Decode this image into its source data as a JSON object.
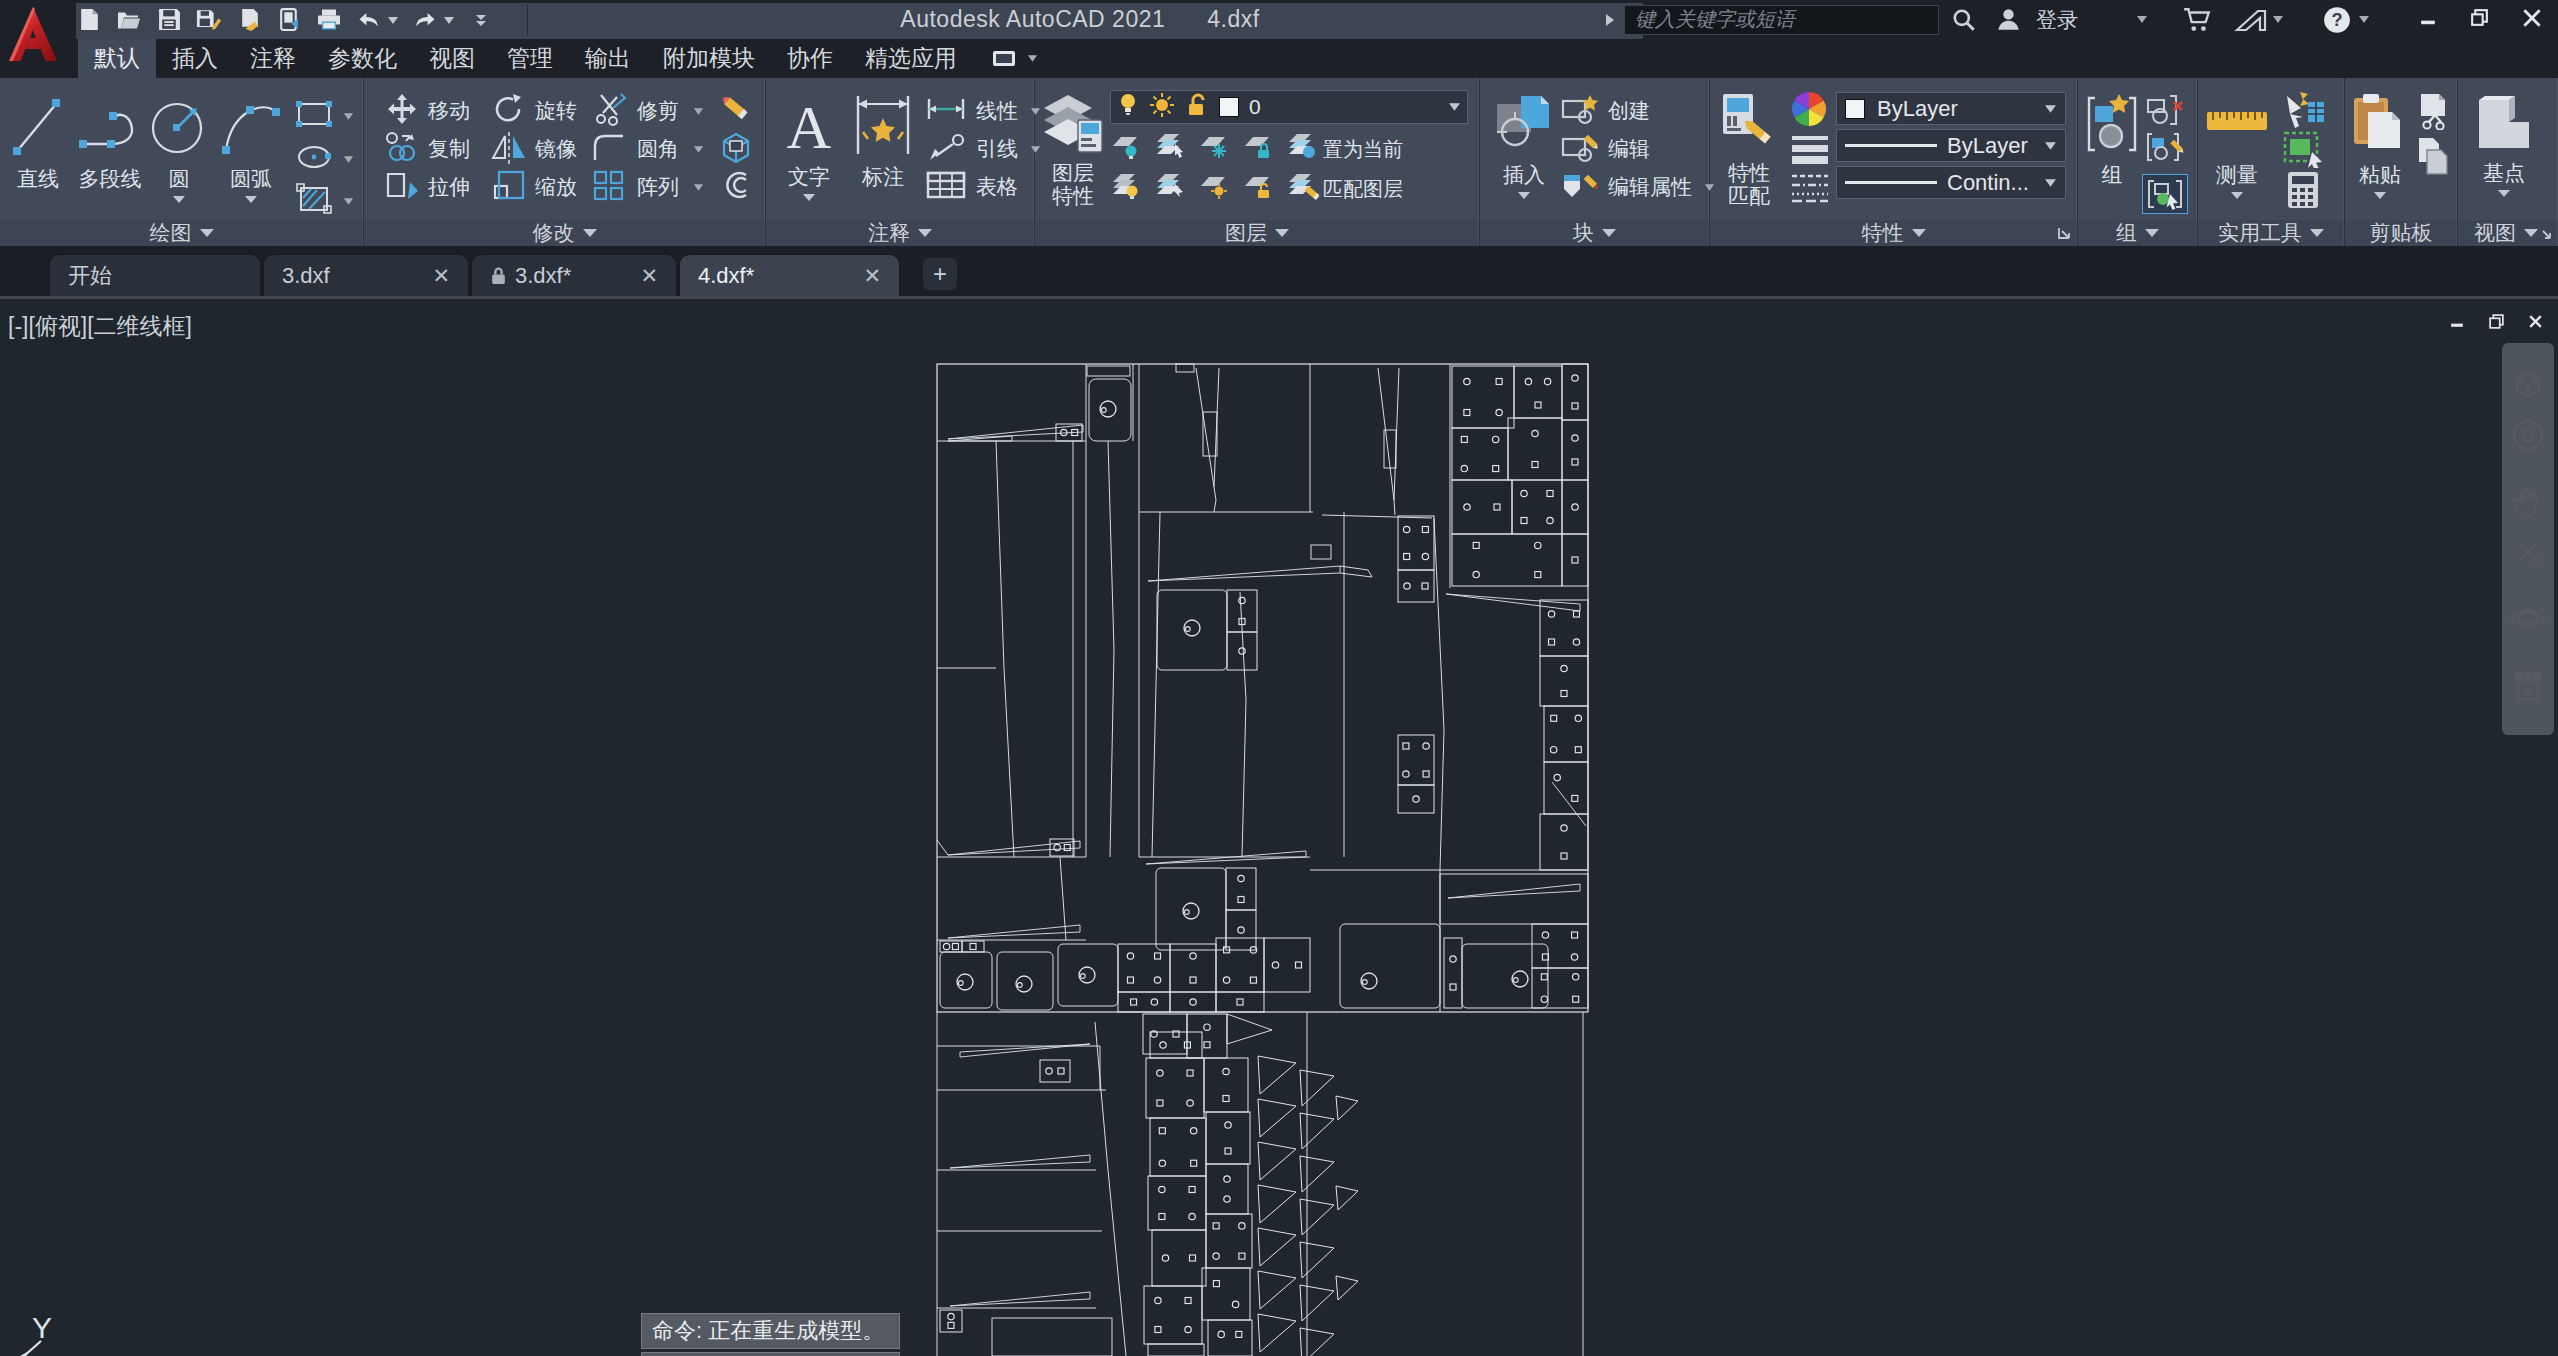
{
  "window": {
    "title_app": "Autodesk AutoCAD 2021",
    "title_file": "4.dxf"
  },
  "titlebar": {
    "search_placeholder": "键入关键字或短语",
    "signin_label": "登录",
    "icons": [
      "new-file-icon",
      "open-icon",
      "save-icon",
      "save-as-icon",
      "plot-icon",
      "publish-icon",
      "print-icon",
      "undo-icon",
      "redo-icon",
      "qat-overflow-icon",
      "search-icon",
      "user-icon",
      "cart-icon",
      "autodesk-icon",
      "help-icon",
      "minimize-icon",
      "restore-icon",
      "close-icon"
    ]
  },
  "ribbon_tabs": [
    {
      "label": "默认",
      "name": "default",
      "active": true
    },
    {
      "label": "插入",
      "name": "insert",
      "active": false
    },
    {
      "label": "注释",
      "name": "annotate",
      "active": false
    },
    {
      "label": "参数化",
      "name": "parametric",
      "active": false
    },
    {
      "label": "视图",
      "name": "view",
      "active": false
    },
    {
      "label": "管理",
      "name": "manage",
      "active": false
    },
    {
      "label": "输出",
      "name": "output",
      "active": false
    },
    {
      "label": "附加模块",
      "name": "add-ins",
      "active": false
    },
    {
      "label": "协作",
      "name": "collaborate",
      "active": false
    },
    {
      "label": "精选应用",
      "name": "featured-apps",
      "active": false
    }
  ],
  "panels": {
    "draw": {
      "label": "绘图",
      "buttons": {
        "line": "直线",
        "polyline": "多段线",
        "circle": "圆",
        "arc": "圆弧"
      }
    },
    "modify": {
      "label": "修改",
      "buttons": {
        "move": "移动",
        "rotate": "旋转",
        "trim": "修剪",
        "copy": "复制",
        "mirror": "镜像",
        "fillet": "圆角",
        "stretch": "拉伸",
        "scale": "缩放",
        "array": "阵列"
      }
    },
    "annotation": {
      "label": "注释",
      "buttons": {
        "text": "文字",
        "dimension": "标注",
        "linear": "线性",
        "leader": "引线",
        "table": "表格"
      }
    },
    "layers": {
      "label": "图层",
      "buttons": {
        "layer_properties": "图层特性",
        "set_current": "置为当前",
        "match_layer": "匹配图层"
      },
      "layer_combo_value": "0"
    },
    "block": {
      "label": "块",
      "buttons": {
        "insert": "插入",
        "create": "创建",
        "edit": "编辑",
        "edit_attribs": "编辑属性"
      }
    },
    "properties": {
      "label": "特性",
      "buttons": {
        "match_props": "特性匹配"
      },
      "combo_color": "ByLayer",
      "combo_lineweight": "ByLayer",
      "combo_linetype": "Contin..."
    },
    "group": {
      "label": "组",
      "buttons": {
        "group": "组"
      }
    },
    "utilities": {
      "label": "实用工具",
      "buttons": {
        "measure": "测量"
      }
    },
    "clipboard": {
      "label": "剪贴板",
      "buttons": {
        "paste": "粘贴"
      }
    },
    "view": {
      "label": "视图",
      "buttons": {
        "base": "基点"
      }
    }
  },
  "file_tabs": [
    {
      "label": "开始",
      "name": "start",
      "close": false,
      "lock": false,
      "active": false,
      "wide": true
    },
    {
      "label": "3.dxf",
      "name": "3dxf",
      "close": true,
      "lock": false,
      "active": false,
      "wide": false
    },
    {
      "label": "3.dxf*",
      "name": "3dxf-modified",
      "close": true,
      "lock": true,
      "active": false,
      "wide": false
    },
    {
      "label": "4.dxf*",
      "name": "4dxf-modified",
      "close": true,
      "lock": false,
      "active": true,
      "wide": false
    }
  ],
  "viewport": {
    "label": "[-][俯视][二维线框]",
    "command_line": "命令: 正在重生成模型。",
    "command_line2": "命令: 正在重生成模型。",
    "ucs_axis_label": "Y"
  },
  "colors": {
    "ribbon_bg": "#3a4150",
    "titlebar_bg": "#1d2127",
    "canvas_bg": "#1f262e",
    "accent_blue": "#4da6dc",
    "accent_yellow": "#e9b73c",
    "logo_red": "#c41f25",
    "line_color": "#dfe3e7"
  }
}
